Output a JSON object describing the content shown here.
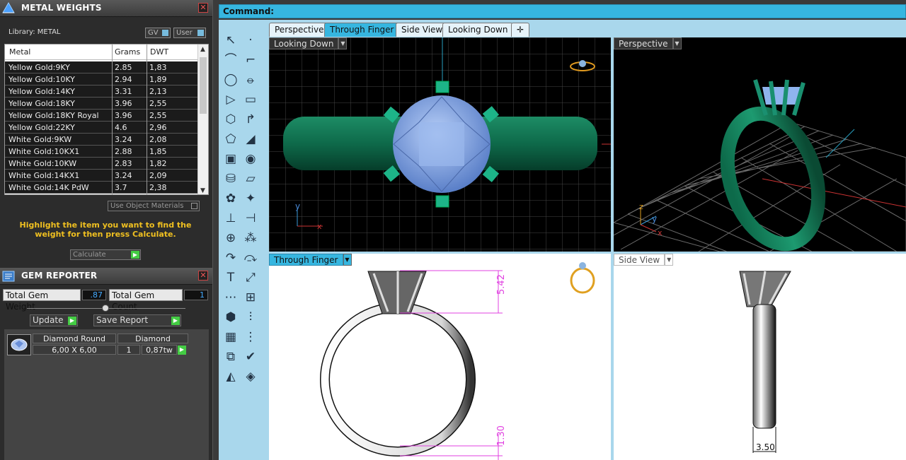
{
  "metal_panel": {
    "title": "METAL WEIGHTS",
    "library_label": "Library: METAL",
    "gv_label": "GV",
    "user_label": "User",
    "columns": [
      "Metal",
      "Grams",
      "DWT"
    ],
    "rows": [
      {
        "metal": "Yellow Gold:9KY",
        "grams": "2.85",
        "dwt": "1,83"
      },
      {
        "metal": "Yellow Gold:10KY",
        "grams": "2.94",
        "dwt": "1,89"
      },
      {
        "metal": "Yellow Gold:14KY",
        "grams": "3.31",
        "dwt": "2,13"
      },
      {
        "metal": "Yellow Gold:18KY",
        "grams": "3.96",
        "dwt": "2,55"
      },
      {
        "metal": "Yellow Gold:18KY Royal",
        "grams": "3.96",
        "dwt": "2,55"
      },
      {
        "metal": "Yellow Gold:22KY",
        "grams": "4.6",
        "dwt": "2,96"
      },
      {
        "metal": "White Gold:9KW",
        "grams": "3.24",
        "dwt": "2,08"
      },
      {
        "metal": "White Gold:10KX1",
        "grams": "2.88",
        "dwt": "1,85"
      },
      {
        "metal": "White Gold:10KW",
        "grams": "2.83",
        "dwt": "1,82"
      },
      {
        "metal": "White Gold:14KX1",
        "grams": "3.24",
        "dwt": "2,09"
      },
      {
        "metal": "White Gold:14K PdW",
        "grams": "3.7",
        "dwt": "2,38"
      }
    ],
    "use_object_materials": "Use Object Materials",
    "hint": "Highlight the item you want to find the weight for then press Calculate.",
    "calculate_label": "Calculate"
  },
  "gem_panel": {
    "title": "GEM REPORTER",
    "total_weight_label": "Total Gem Weight",
    "total_weight_value": ".87",
    "total_count_label": "Total Gem Count",
    "total_count_value": "1",
    "update_label": "Update",
    "save_report_label": "Save Report",
    "gem": {
      "name": "Diamond Round",
      "size": "6,00 X 6,00",
      "type": "Diamond",
      "count": "1",
      "weight": "0,87tw"
    }
  },
  "command": {
    "label": "Command:"
  },
  "tabs": [
    "Perspective",
    "Through Finger",
    "Side View",
    "Looking Down"
  ],
  "active_tab": "Through Finger",
  "viewports": {
    "top_left": "Looking Down",
    "top_right": "Perspective",
    "bottom_left": "Through Finger",
    "bottom_right": "Side View"
  },
  "dimensions": {
    "height_top": "5.42",
    "height_bottom": "1.30",
    "width_side": "3.50"
  },
  "axis_labels": {
    "y": "y",
    "x": "x",
    "z": "z"
  },
  "colors": {
    "accent": "#36b6e0",
    "toolbar_bg": "#a9d7ec",
    "metal_green": "#127a58",
    "gem_blue": "#8fb4ee",
    "dimension_magenta": "#e040e0",
    "hint_yellow": "#f0c020"
  },
  "toolbar_icons": [
    "select-arrow-icon",
    "point-icon",
    "polyline-icon",
    "curve-edit-icon",
    "circle-icon",
    "ellipse-icon",
    "triangle-icon",
    "rectangle-icon",
    "polygon-icon",
    "fillet-curve-icon",
    "freeform-curve-icon",
    "sweep-icon",
    "box-solid-icon",
    "sphere-solid-icon",
    "cylinder-solid-icon",
    "plane-surface-icon",
    "gem-tools-icon",
    "fire-effect-icon",
    "transform-icon",
    "align-icon",
    "boolean-icon",
    "group-icon",
    "curve-offset-icon",
    "array-icon",
    "text-T-icon",
    "scale-icon",
    "grid-array-icon",
    "mirror-icon",
    "view-cube-icon",
    "dimension-icon",
    "pattern-icon",
    "stack-icon",
    "extrude-icon",
    "check-icon",
    "render-icon",
    "paint-icon"
  ]
}
